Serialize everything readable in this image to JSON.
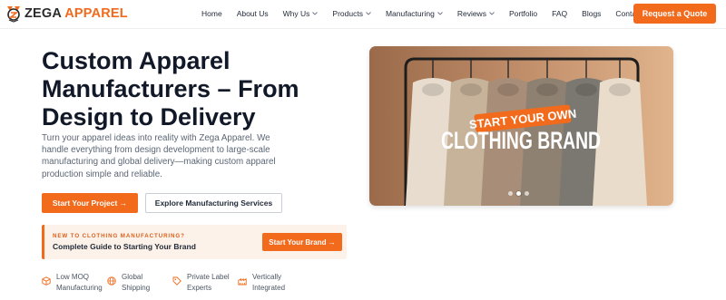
{
  "brand": {
    "name_part1": "ZEGA",
    "name_part2": "APPAREL",
    "accent": "#f26a1b"
  },
  "nav": {
    "items": [
      {
        "label": "Home",
        "dropdown": false
      },
      {
        "label": "About Us",
        "dropdown": false
      },
      {
        "label": "Why Us",
        "dropdown": true
      },
      {
        "label": "Products",
        "dropdown": true
      },
      {
        "label": "Manufacturing",
        "dropdown": true
      },
      {
        "label": "Reviews",
        "dropdown": true
      },
      {
        "label": "Portfolio",
        "dropdown": false
      },
      {
        "label": "FAQ",
        "dropdown": false
      },
      {
        "label": "Blogs",
        "dropdown": false
      },
      {
        "label": "Contact",
        "dropdown": false
      }
    ],
    "cta": "Request a Quote"
  },
  "hero": {
    "title_lines": [
      "Custom Apparel",
      "Manufacturers – From",
      "Design to Delivery"
    ],
    "description": "Turn your apparel ideas into reality with Zega Apparel. We handle everything from design development to large-scale manufacturing and global delivery—making custom apparel production simple and reliable.",
    "primary_button": "Start Your Project →",
    "secondary_button": "Explore Manufacturing Services"
  },
  "callout": {
    "eyebrow": "NEW TO CLOTHING MANUFACTURING?",
    "title": "Complete Guide to Starting Your Brand",
    "button": "Start Your Brand →"
  },
  "features": [
    {
      "icon": "box-icon",
      "lines": [
        "Low MOQ",
        "Manufacturing"
      ]
    },
    {
      "icon": "globe-icon",
      "lines": [
        "Global",
        "Shipping"
      ]
    },
    {
      "icon": "tag-icon",
      "lines": [
        "Private Label",
        "Experts"
      ]
    },
    {
      "icon": "factory-icon",
      "lines": [
        "Vertically",
        "Integrated"
      ]
    }
  ],
  "slide": {
    "badge": "START YOUR OWN",
    "headline": "CLOTHING BRAND",
    "dots_total": 3,
    "active_dot": 1
  }
}
